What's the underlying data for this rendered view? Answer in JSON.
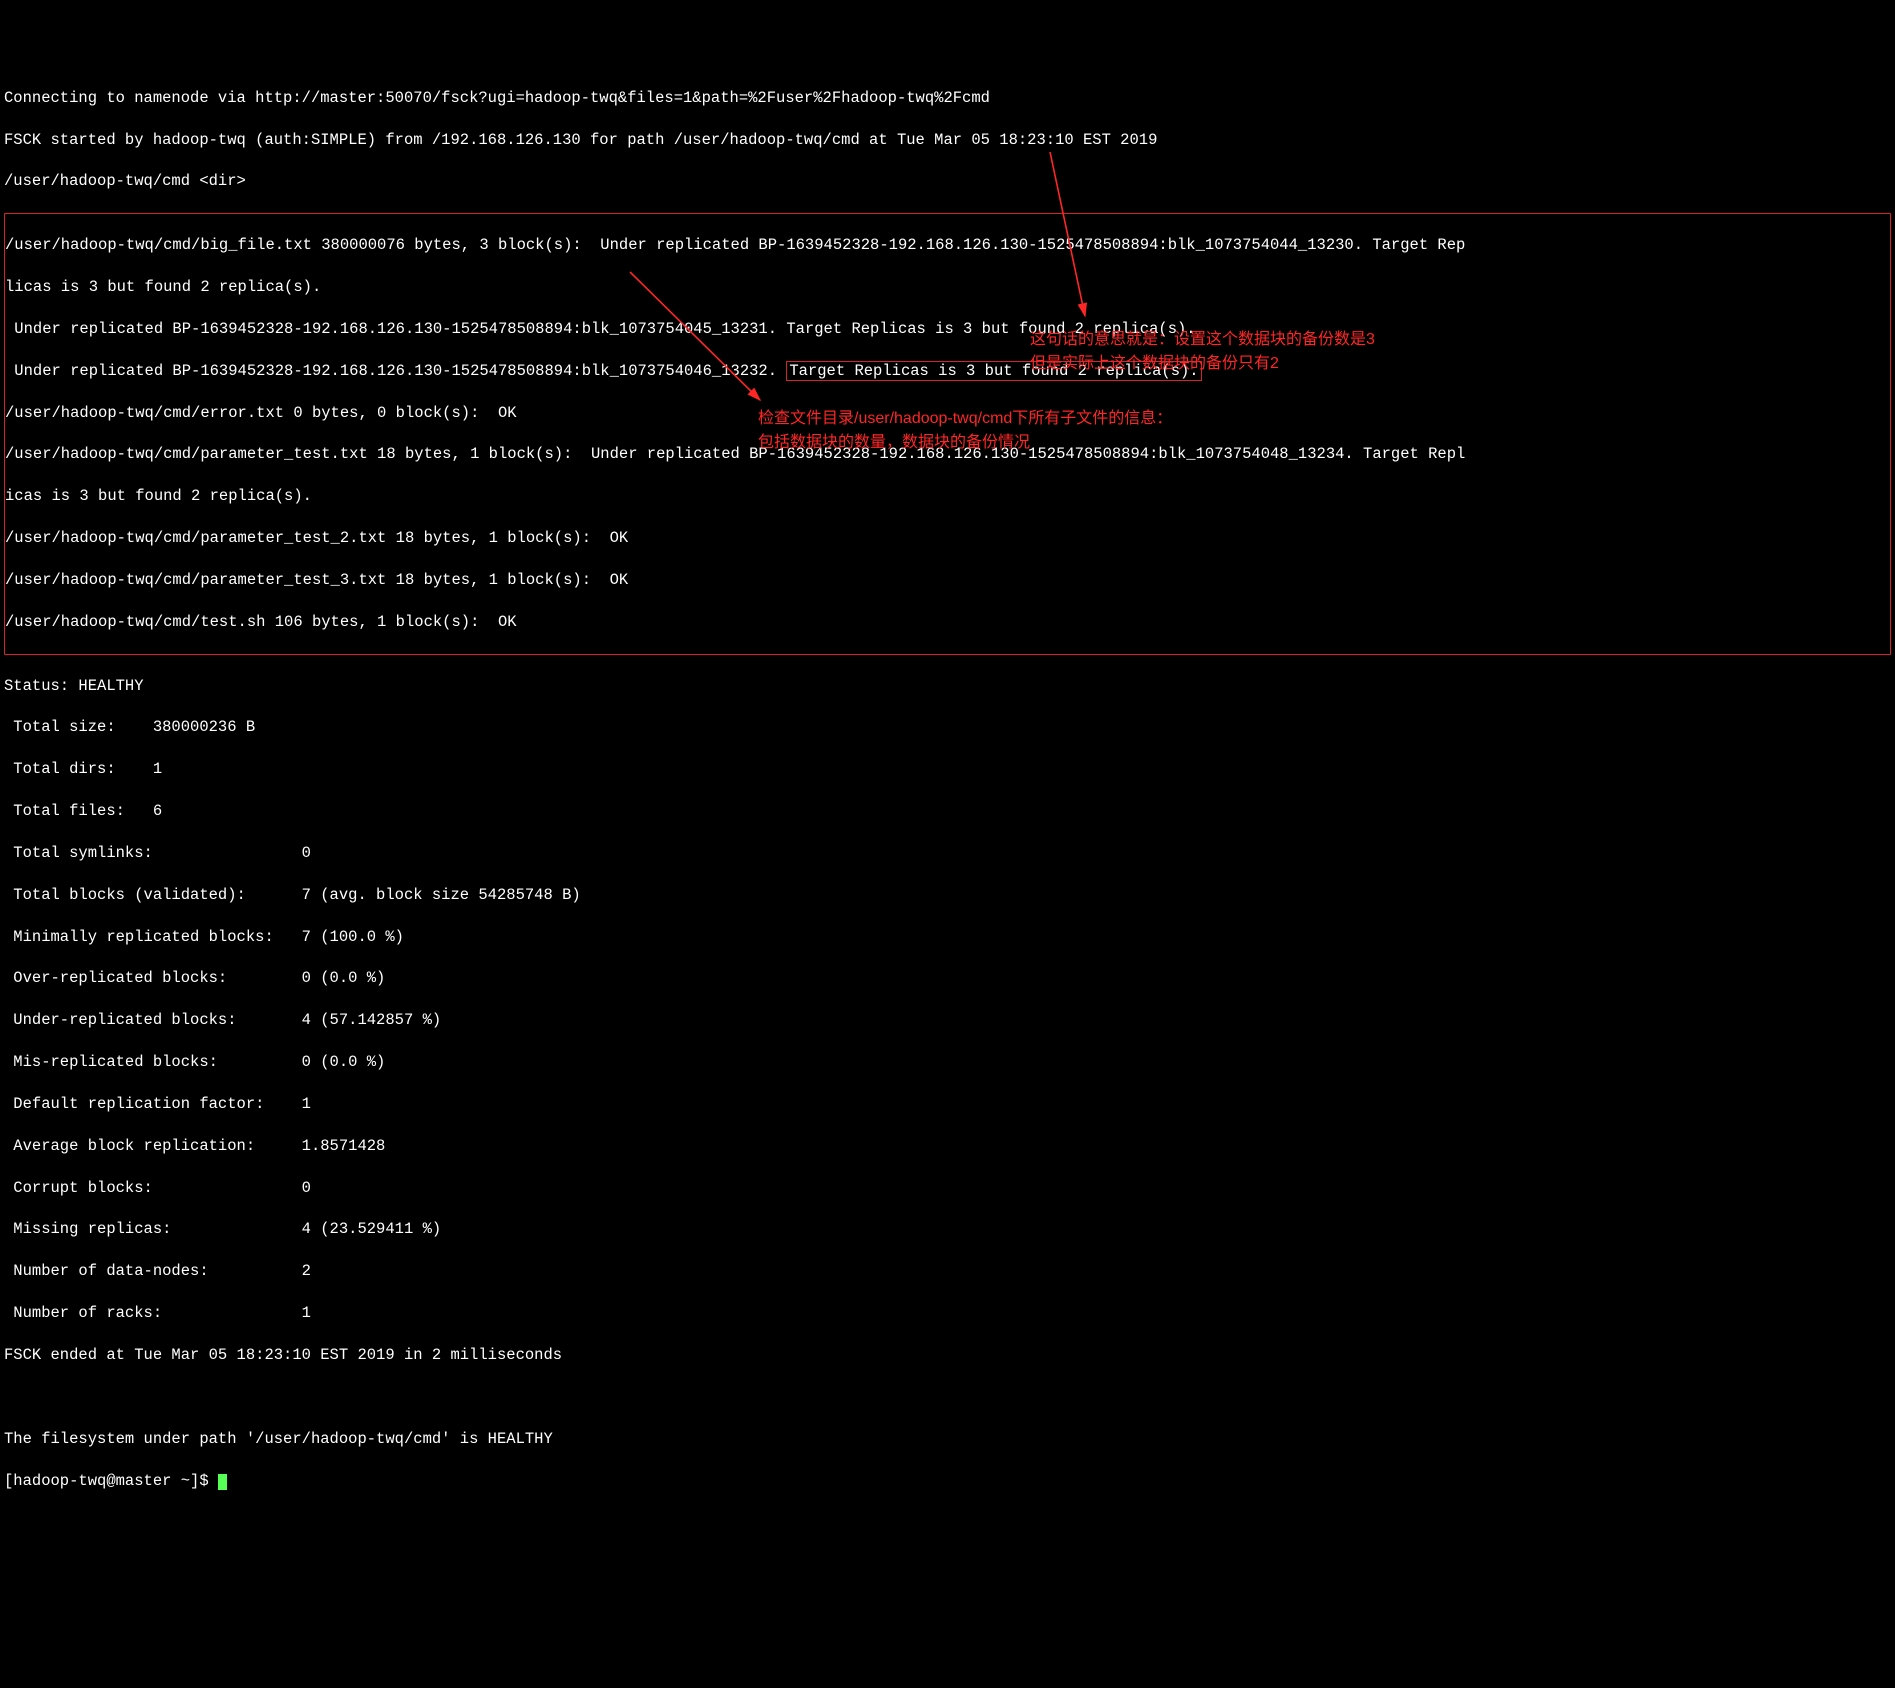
{
  "header": {
    "connecting": "Connecting to namenode via http://master:50070/fsck?ugi=hadoop-twq&files=1&path=%2Fuser%2Fhadoop-twq%2Fcmd",
    "fsck_started": "FSCK started by hadoop-twq (auth:SIMPLE) from /192.168.126.130 for path /user/hadoop-twq/cmd at Tue Mar 05 18:23:10 EST 2019",
    "dir_line": "/user/hadoop-twq/cmd <dir>"
  },
  "block_section": {
    "line1_a": "/user/hadoop-twq/cmd/big_file.txt 380000076 bytes, 3 block(s):  Under replicated BP-1639452328-192.168.126.130-1525478508894:blk_1073754044_13230. Target Rep",
    "line1_b": "licas is 3 but found 2 replica(s).",
    "line2": " Under replicated BP-1639452328-192.168.126.130-1525478508894:blk_1073754045_13231. Target Replicas is 3 but found 2 replica(s).",
    "line3_a": " Under replicated BP-1639452328-192.168.126.130-1525478508894:blk_1073754046_13232. ",
    "line3_box": "Target Replicas is 3 but found 2 replica(s).",
    "line4": "/user/hadoop-twq/cmd/error.txt 0 bytes, 0 block(s):  OK",
    "line5_a": "/user/hadoop-twq/cmd/parameter_test.txt 18 bytes, 1 block(s):  Under replicated BP-1639452328-192.168.126.130-1525478508894:blk_1073754048_13234. Target Repl",
    "line5_b": "icas is 3 but found 2 replica(s).",
    "line6": "/user/hadoop-twq/cmd/parameter_test_2.txt 18 bytes, 1 block(s):  OK",
    "line7": "/user/hadoop-twq/cmd/parameter_test_3.txt 18 bytes, 1 block(s):  OK",
    "line8": "/user/hadoop-twq/cmd/test.sh 106 bytes, 1 block(s):  OK"
  },
  "status": {
    "status_line": "Status: HEALTHY",
    "stats": [
      " Total size:    380000236 B",
      " Total dirs:    1",
      " Total files:   6",
      " Total symlinks:                0",
      " Total blocks (validated):      7 (avg. block size 54285748 B)",
      " Minimally replicated blocks:   7 (100.0 %)",
      " Over-replicated blocks:        0 (0.0 %)",
      " Under-replicated blocks:       4 (57.142857 %)",
      " Mis-replicated blocks:         0 (0.0 %)",
      " Default replication factor:    1",
      " Average block replication:     1.8571428",
      " Corrupt blocks:                0",
      " Missing replicas:              4 (23.529411 %)",
      " Number of data-nodes:          2",
      " Number of racks:               1"
    ],
    "fsck_ended": "FSCK ended at Tue Mar 05 18:23:10 EST 2019 in 2 milliseconds",
    "blank": "",
    "healthy": "The filesystem under path '/user/hadoop-twq/cmd' is HEALTHY",
    "prompt": "[hadoop-twq@master ~]$ "
  },
  "annotations": {
    "right": "这句话的意思就是：设置这个数据块的备份数是3\n但是实际上这个数据块的备份只有2",
    "left_a": "检查文件目录/user/hadoop-twq/cmd下所有子文件的信息：",
    "left_b": "包括数据块的数量，数据块的备份情况"
  }
}
